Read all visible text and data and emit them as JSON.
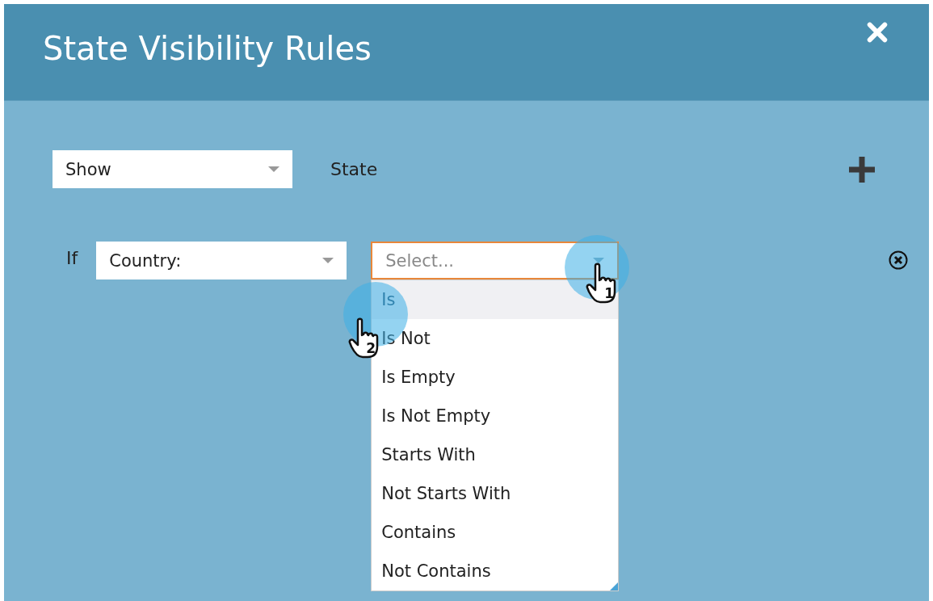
{
  "dialog": {
    "title": "State Visibility Rules"
  },
  "action_select": {
    "value": "Show"
  },
  "target_label": "State",
  "condition": {
    "prefix": "If",
    "field_select": {
      "value": "Country:"
    },
    "operator_select": {
      "placeholder": "Select...",
      "focused": true,
      "expanded": true
    },
    "options": [
      {
        "label": "Is",
        "selected": true
      },
      {
        "label": "Is Not",
        "selected": false
      },
      {
        "label": "Is Empty",
        "selected": false
      },
      {
        "label": "Is Not Empty",
        "selected": false
      },
      {
        "label": "Starts With",
        "selected": false
      },
      {
        "label": "Not Starts With",
        "selected": false
      },
      {
        "label": "Contains",
        "selected": false
      },
      {
        "label": "Not Contains",
        "selected": false
      }
    ]
  },
  "pointers": [
    {
      "label": "1"
    },
    {
      "label": "2"
    }
  ]
}
